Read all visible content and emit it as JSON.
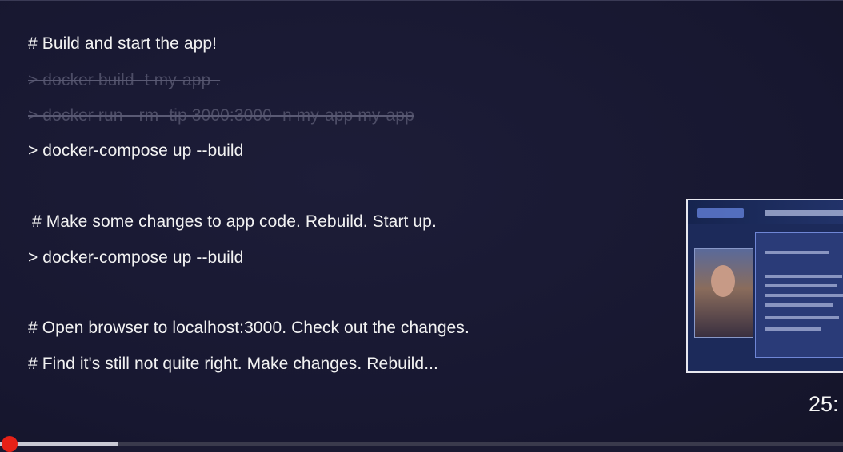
{
  "slide": {
    "lines": [
      "# Build and start the app!",
      "> docker build -t my-app .",
      "> docker run --rm -tip 3000:3000 -n my-app my-app",
      "> docker-compose up --build",
      "# Make some changes to app code. Rebuild. Start up.",
      "> docker-compose up --build",
      "# Open browser to localhost:3000. Check out the changes.",
      "# Find it's still not quite right. Make changes. Rebuild..."
    ]
  },
  "player": {
    "timestamp": "25:",
    "progress_fraction": 0.14
  },
  "colors": {
    "background": "#1a1a32",
    "text": "#f2f2f2",
    "struck_text": "#4d4d66",
    "scrubber": "#e62117"
  }
}
